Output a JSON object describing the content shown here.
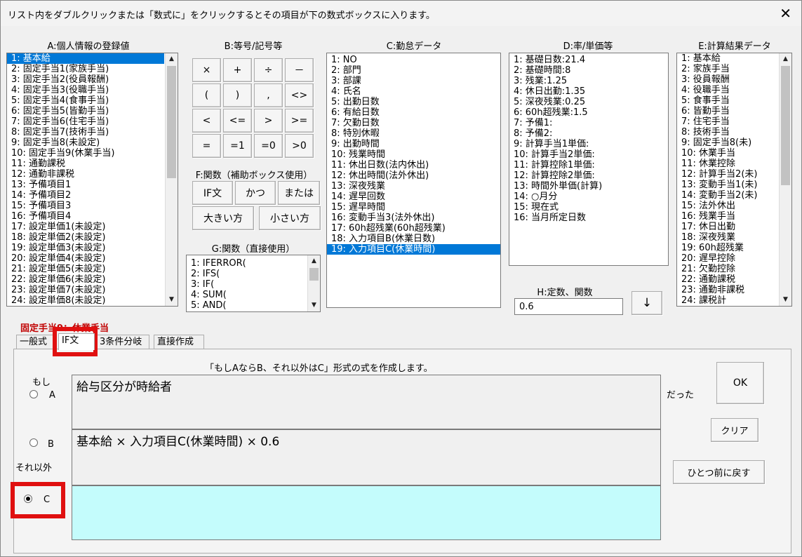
{
  "window": {
    "title": "リスト内をダブルクリックまたは「数式に」をクリックするとその項目が下の数式ボックスに入ります。",
    "close_glyph": "✕"
  },
  "headers": {
    "a": "A:個人情報の登録値",
    "b": "B:等号/記号等",
    "c": "C:勤怠データ",
    "d": "D:率/単価等",
    "e": "E:計算結果データ",
    "f": "F:関数（補助ボックス使用）",
    "g": "G:関数（直接使用）",
    "h": "H:定数、関数"
  },
  "list_a": [
    "1: 基本給",
    "2: 固定手当1(家族手当)",
    "3: 固定手当2(役員報酬)",
    "4: 固定手当3(役職手当)",
    "5: 固定手当4(食事手当)",
    "6: 固定手当5(皆勤手当)",
    "7: 固定手当6(住宅手当)",
    "8: 固定手当7(技術手当)",
    "9: 固定手当8(未設定)",
    "10: 固定手当9(休業手当)",
    "11: 通勤課税",
    "12: 通勤非課税",
    "13: 予備項目1",
    "14: 予備項目2",
    "15: 予備項目3",
    "16: 予備項目4",
    "17: 設定単価1(未設定)",
    "18: 設定単価2(未設定)",
    "19: 設定単価3(未設定)",
    "20: 設定単価4(未設定)",
    "21: 設定単価5(未設定)",
    "22: 設定単価6(未設定)",
    "23: 設定単価7(未設定)",
    "24: 設定単価8(未設定)"
  ],
  "symbols": [
    "×",
    "+",
    "÷",
    "－",
    "(",
    ")",
    ",",
    "<>",
    "<",
    "<=",
    ">",
    ">=",
    "=",
    "=1",
    "=0",
    ">0"
  ],
  "func_buttons": [
    "IF文",
    "かつ",
    "または",
    "大きい方",
    "小さい方"
  ],
  "list_g": [
    "1: IFERROR(",
    "2: IFS(",
    "3: IF(",
    "4: SUM(",
    "5: AND("
  ],
  "list_c": [
    "1: NO",
    "2: 部門",
    "3: 部課",
    "4: 氏名",
    "5: 出勤日数",
    "6: 有給日数",
    "7: 欠勤日数",
    "8: 特別休暇",
    "9: 出勤時間",
    "10: 残業時間",
    "11: 休出日数(法内休出)",
    "12: 休出時間(法外休出)",
    "13: 深夜残業",
    "14: 遅早回数",
    "15: 遅早時間",
    "16: 変動手当3(法外休出)",
    "17: 60h超残業(60h超残業)",
    "18: 入力項目B(休業日数)",
    "19: 入力項目C(休業時間)"
  ],
  "list_d": [
    "1: 基礎日数:21.4",
    "2: 基礎時間:8",
    "3: 残業:1.25",
    "4: 休日出勤:1.35",
    "5: 深夜残業:0.25",
    "6: 60h超残業:1.5",
    "7: 予備1:",
    "8: 予備2:",
    "9: 計算手当1単価:",
    "10: 計算手当2単価:",
    "11: 計算控除1単価:",
    "12: 計算控除2単価:",
    "13: 時間外単価(計算)",
    "14: ○月分",
    "15: 現在式",
    "16: 当月所定日数"
  ],
  "list_e": [
    "1: 基本給",
    "2: 家族手当",
    "3: 役員報酬",
    "4: 役職手当",
    "5: 食事手当",
    "6: 皆勤手当",
    "7: 住宅手当",
    "8: 技術手当",
    "9: 固定手当8(未)",
    "10: 休業手当",
    "11: 休業控除",
    "12: 計算手当2(未)",
    "13: 変動手当1(未)",
    "14: 変動手当2(未)",
    "15: 法外休出",
    "16: 残業手当",
    "17: 休日出勤",
    "18: 深夜残業",
    "19: 60h超残業",
    "20: 遅早控除",
    "21: 欠勤控除",
    "22: 通勤課税",
    "23: 通勤非課税",
    "24: 課税計"
  ],
  "constant": {
    "value": "0.6",
    "arrow": "↓"
  },
  "selected_item": "固定手当9：休業手当",
  "tabs": [
    "一般式",
    "IF文",
    "3条件分岐",
    "直接作成"
  ],
  "if_panel": {
    "description": "「もしAならB、それ以外はC」形式の式を作成します。",
    "moshi": "もし",
    "a": "A",
    "b": "B",
    "c": "C",
    "sore_igai": "それ以外",
    "datta": "だった",
    "box_a": "給与区分が時給者",
    "box_b": "基本給 × 入力項目C(休業時間) × 0.6",
    "box_c": "",
    "ok": "OK",
    "clear": "クリア",
    "undo": "ひとつ前に戻す"
  }
}
